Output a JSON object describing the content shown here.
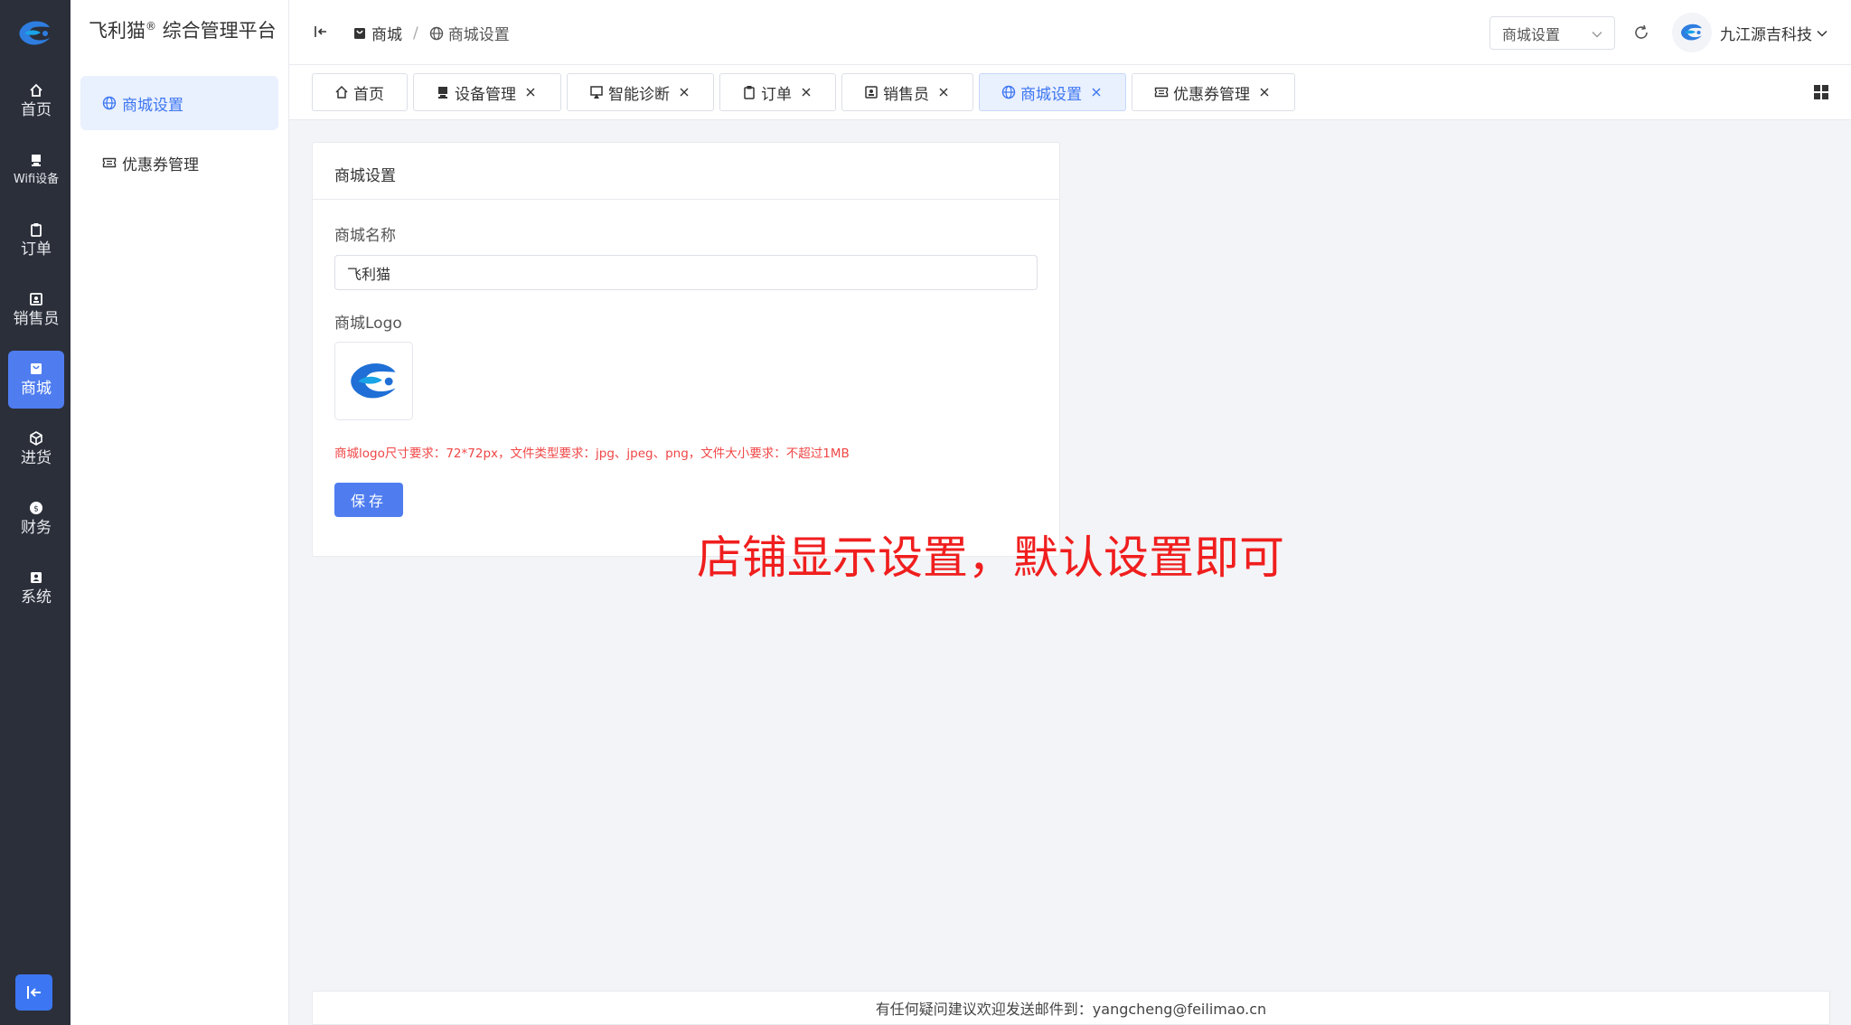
{
  "rail": {
    "items": [
      {
        "label": "首页",
        "icon": "home-icon"
      },
      {
        "label": "Wifi设备",
        "icon": "monitor-icon"
      },
      {
        "label": "订单",
        "icon": "clipboard-icon"
      },
      {
        "label": "销售员",
        "icon": "id-card-icon"
      },
      {
        "label": "商城",
        "icon": "shop-bag-icon",
        "active": true
      },
      {
        "label": "进货",
        "icon": "box-icon"
      },
      {
        "label": "财务",
        "icon": "coin-icon"
      },
      {
        "label": "系统",
        "icon": "user-card-icon"
      }
    ]
  },
  "sidebar": {
    "title": "飞利猫",
    "title_mark": "®",
    "title_suffix": " 综合管理平台",
    "items": [
      {
        "label": "商城设置",
        "icon": "globe-icon",
        "active": true
      },
      {
        "label": "优惠券管理",
        "icon": "ticket-icon"
      }
    ]
  },
  "header": {
    "breadcrumb": [
      {
        "label": "商城",
        "icon": "shop-bag-icon"
      },
      {
        "label": "商城设置",
        "icon": "globe-icon"
      }
    ],
    "breadcrumb_sep": "/",
    "page_select": "商城设置",
    "user_name": "九江源吉科技"
  },
  "tabs": [
    {
      "label": "首页",
      "icon": "home-icon",
      "closable": false
    },
    {
      "label": "设备管理",
      "icon": "monitor-icon",
      "closable": true
    },
    {
      "label": "智能诊断",
      "icon": "airplay-icon",
      "closable": true
    },
    {
      "label": "订单",
      "icon": "clipboard-icon",
      "closable": true
    },
    {
      "label": "销售员",
      "icon": "id-card-icon",
      "closable": true
    },
    {
      "label": "商城设置",
      "icon": "globe-icon",
      "closable": true,
      "active": true
    },
    {
      "label": "优惠券管理",
      "icon": "ticket-icon",
      "closable": true
    }
  ],
  "form": {
    "card_title": "商城设置",
    "name_label": "商城名称",
    "name_value": "飞利猫",
    "logo_label": "商城Logo",
    "hint": "商城logo尺寸要求：72*72px，文件类型要求：jpg、jpeg、png，文件大小要求：不超过1MB",
    "save_label": "保存"
  },
  "annotation": "店铺显示设置，默认设置即可",
  "footer": "有任何疑问建议欢迎发送邮件到：yangcheng@feilimao.cn",
  "colors": {
    "rail_bg": "#2b2f3a",
    "accent": "#4f7df0",
    "active_bg": "#e9f0fe",
    "hint_red": "#f04646",
    "annotation_red": "#f01e1e"
  }
}
